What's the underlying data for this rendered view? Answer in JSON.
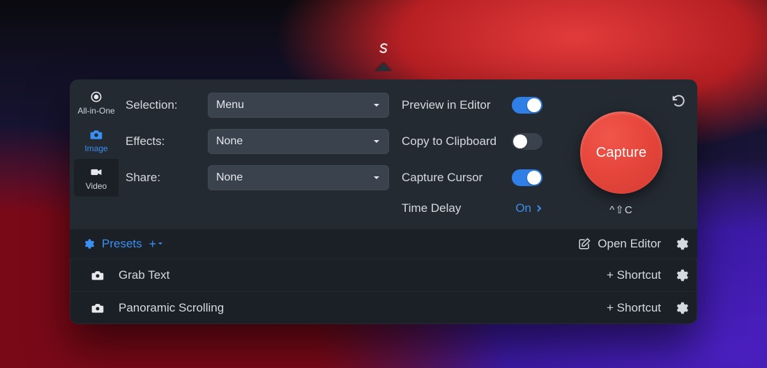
{
  "sidebar": {
    "tabs": [
      {
        "label": "All-in-One",
        "icon": "target-icon"
      },
      {
        "label": "Image",
        "icon": "camera-icon"
      },
      {
        "label": "Video",
        "icon": "video-icon"
      }
    ],
    "selected_index": 1
  },
  "settings": {
    "rows": [
      {
        "label": "Selection:",
        "value": "Menu"
      },
      {
        "label": "Effects:",
        "value": "None"
      },
      {
        "label": "Share:",
        "value": "None"
      }
    ]
  },
  "options": {
    "preview_in_editor": {
      "label": "Preview in Editor",
      "on": true
    },
    "copy_to_clipboard": {
      "label": "Copy to Clipboard",
      "on": false
    },
    "capture_cursor": {
      "label": "Capture Cursor",
      "on": true
    },
    "time_delay": {
      "label": "Time Delay",
      "value": "On"
    }
  },
  "capture": {
    "button_label": "Capture",
    "shortcut_hint": "^⇧C"
  },
  "presets_bar": {
    "label": "Presets",
    "add_label": "+",
    "open_editor_label": "Open Editor"
  },
  "presets": [
    {
      "name": "Grab Text",
      "shortcut_label": "+ Shortcut"
    },
    {
      "name": "Panoramic Scrolling",
      "shortcut_label": "+ Shortcut"
    }
  ]
}
